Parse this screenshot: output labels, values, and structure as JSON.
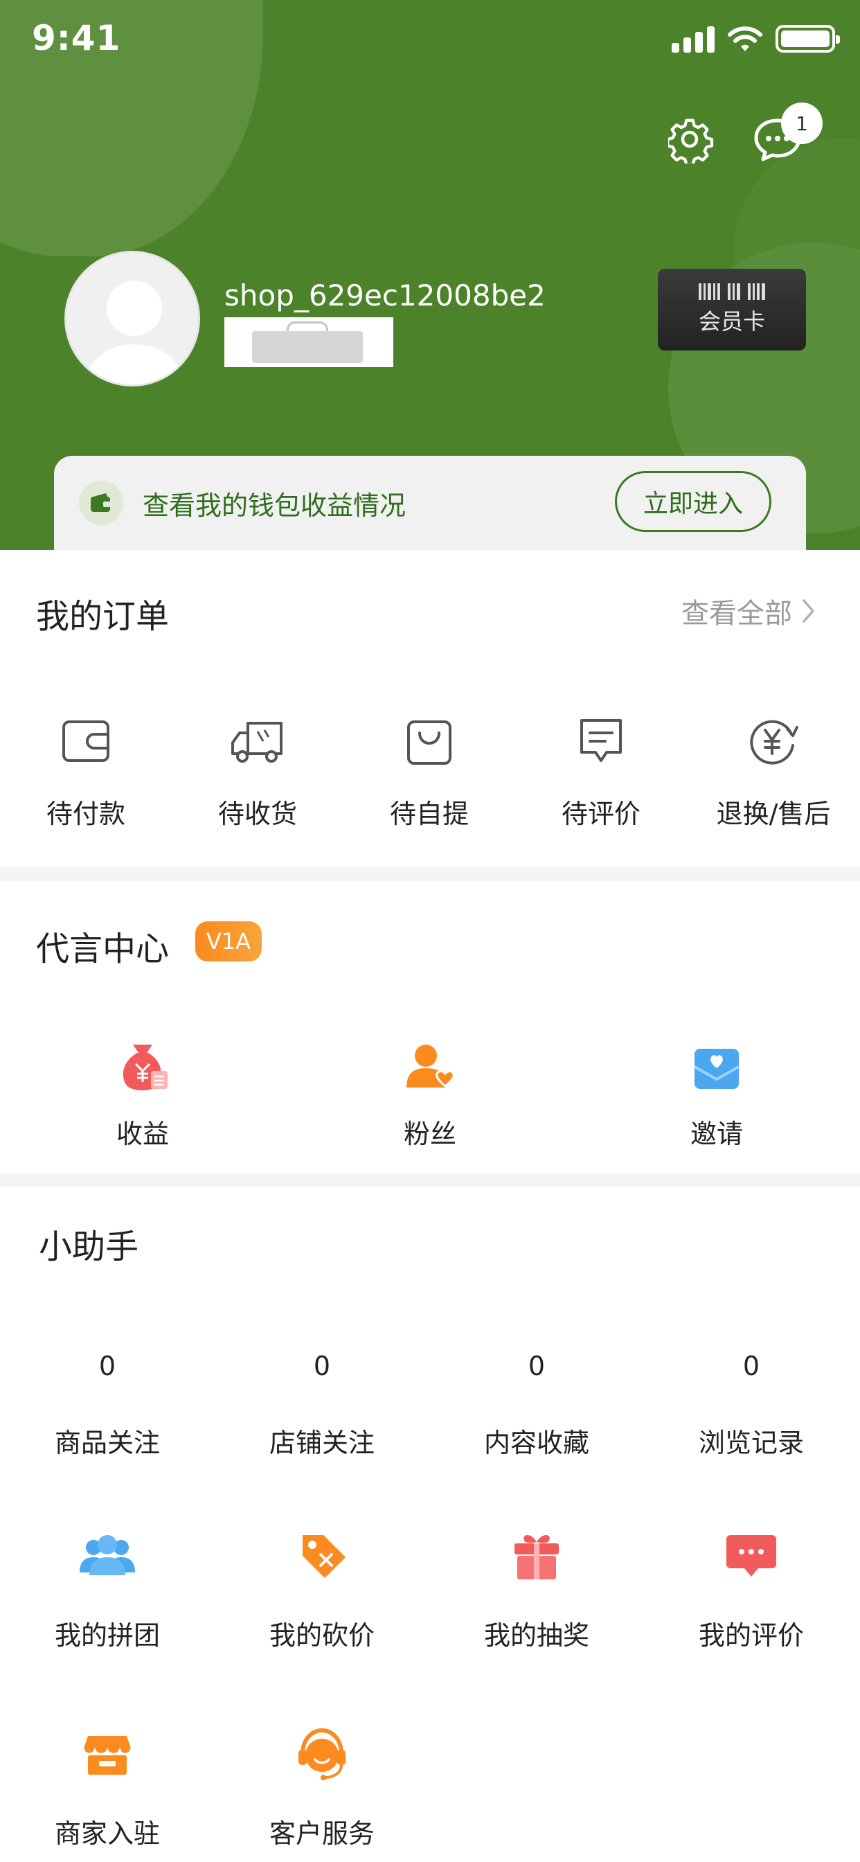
{
  "status_bar": {
    "time": "9:41"
  },
  "header": {
    "message_badge": "1",
    "username": "shop_629ec12008be2",
    "vip_card_label": "会员卡",
    "wallet": {
      "text": "查看我的钱包收益情况",
      "button": "立即进入"
    }
  },
  "orders": {
    "title": "我的订单",
    "view_all": "查看全部",
    "items": [
      {
        "label": "待付款",
        "icon": "wallet-icon"
      },
      {
        "label": "待收货",
        "icon": "truck-icon"
      },
      {
        "label": "待自提",
        "icon": "shopping-bag-icon"
      },
      {
        "label": "待评价",
        "icon": "comment-icon"
      },
      {
        "label": "退换/售后",
        "icon": "refund-icon"
      }
    ]
  },
  "spokesperson": {
    "title": "代言中心",
    "badge": "V1A",
    "items": [
      {
        "label": "收益",
        "icon": "money-bag-icon"
      },
      {
        "label": "粉丝",
        "icon": "fans-icon"
      },
      {
        "label": "邀请",
        "icon": "invite-envelope-icon"
      }
    ]
  },
  "assistant": {
    "title": "小助手",
    "stats": [
      {
        "value": "0",
        "label": "商品关注"
      },
      {
        "value": "0",
        "label": "店铺关注"
      },
      {
        "value": "0",
        "label": "内容收藏"
      },
      {
        "value": "0",
        "label": "浏览记录"
      }
    ],
    "tools": [
      {
        "label": "我的拼团",
        "icon": "group-buy-icon"
      },
      {
        "label": "我的砍价",
        "icon": "bargain-tag-icon"
      },
      {
        "label": "我的抽奖",
        "icon": "gift-box-icon"
      },
      {
        "label": "我的评价",
        "icon": "review-bubble-icon"
      },
      {
        "label": "商家入驻",
        "icon": "store-icon"
      },
      {
        "label": "客户服务",
        "icon": "customer-service-icon"
      }
    ]
  },
  "colors": {
    "header_green": "#4c832a",
    "accent_green": "#2f6e1c",
    "badge_orange": "#fb8a1f",
    "icon_red": "#f25b5b",
    "icon_orange": "#fb8a1f",
    "icon_blue": "#4aa7f0"
  }
}
